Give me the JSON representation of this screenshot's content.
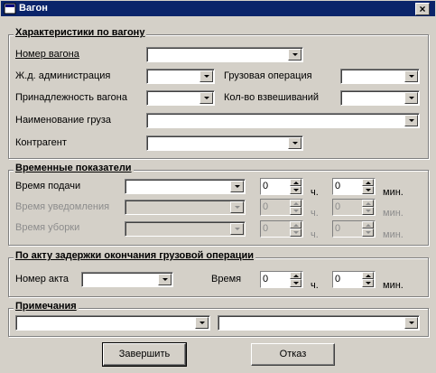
{
  "window": {
    "title": "Вагон",
    "close_glyph": "×"
  },
  "groups": {
    "wagon": {
      "legend": "Характеристики по вагону",
      "number_label": "Номер вагона",
      "railway_label": "Ж.д. администрация",
      "ownership_label": "Принадлежность вагона",
      "cargo_name_label": "Наименование груза",
      "counterparty_label": "Контрагент",
      "cargo_op_label": "Грузовая операция",
      "weighings_label": "Кол-во взвешиваний"
    },
    "time": {
      "legend": "Временные показатели",
      "rows": [
        {
          "label": "Время подачи",
          "hours": "0",
          "minutes": "0",
          "h_unit": "ч.",
          "m_unit": "мин."
        },
        {
          "label": "Время уведомления",
          "hours": "0",
          "minutes": "0",
          "h_unit": "ч.",
          "m_unit": "мин."
        },
        {
          "label": "Время уборки",
          "hours": "0",
          "minutes": "0",
          "h_unit": "ч.",
          "m_unit": "мин."
        }
      ]
    },
    "act": {
      "legend": "По акту задержки окончания грузовой операции",
      "act_number_label": "Номер акта",
      "time_label": "Время",
      "hours": "0",
      "minutes": "0",
      "h_unit": "ч.",
      "m_unit": "мин."
    },
    "notes": {
      "legend": "Примечания"
    }
  },
  "buttons": {
    "finish": "Завершить",
    "cancel": "Отказ"
  },
  "colors": {
    "titlebar": "#0a246a",
    "face": "#d4d0c8"
  }
}
